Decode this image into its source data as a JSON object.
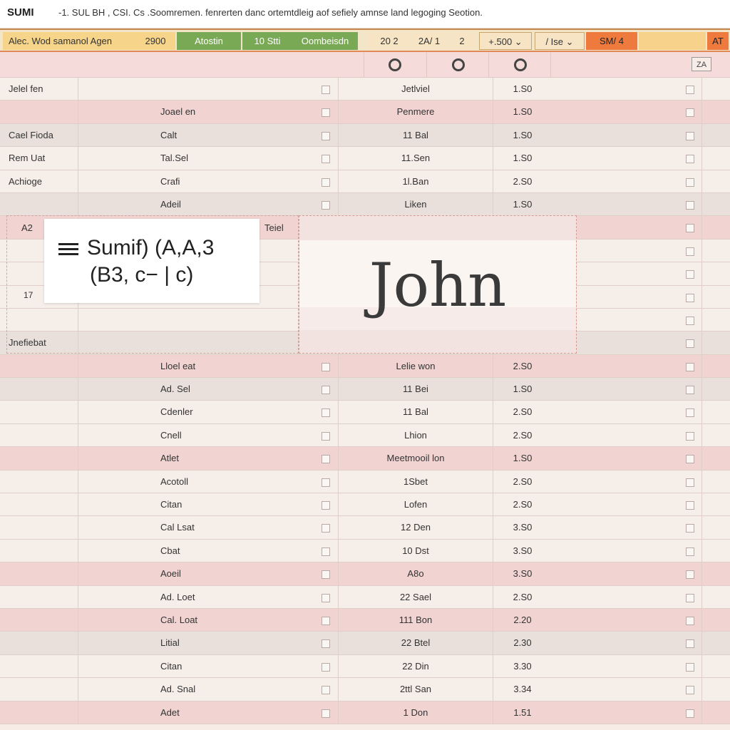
{
  "title_bar": {
    "app": "SUMI",
    "caption": "-1.  SUL BH , CSI. Cs .Soomremen. fenrerten  danc  ortemtdleig  aof  sefiely  amnse  land  legoging  Seotion."
  },
  "toolbar": {
    "items": [
      {
        "label": "Alec. Wod samanol  Agen"
      },
      {
        "label": "2900"
      },
      {
        "label": "Atostin"
      },
      {
        "label": "10  Stti"
      },
      {
        "label": "Oombeisdn"
      },
      {
        "label": "20  2"
      },
      {
        "label": "2A/ 1"
      },
      {
        "label": "2"
      },
      {
        "label": "+.500  ⌄"
      },
      {
        "label": "/  Ise  ⌄"
      },
      {
        "label": "SM/ 4"
      },
      {
        "label": ""
      },
      {
        "label": "AT"
      }
    ]
  },
  "column_header": {
    "corner_label": "ZA"
  },
  "rows": [
    {
      "a": "Jelel  fen",
      "b": "",
      "c": "Jetlviel",
      "d": "1.S0",
      "shade": "light"
    },
    {
      "a": "",
      "b": "Joael  en",
      "c": "Penmere",
      "d": "1.S0",
      "shade": "pink"
    },
    {
      "a": "Cael  Fioda",
      "b": "Calt",
      "c": "11 Bal",
      "d": "1.S0",
      "shade": "grey"
    },
    {
      "a": "Rem  Uat",
      "b": "Tal.Sel",
      "c": "11.Sen",
      "d": "1.S0",
      "shade": "light"
    },
    {
      "a": "Achioge",
      "b": "Crafi",
      "c": "1l.Ban",
      "d": "2.S0",
      "shade": "light"
    },
    {
      "a": "",
      "b": "Adeil",
      "c": "Liken",
      "d": "1.S0",
      "shade": "grey"
    },
    {
      "a": "",
      "b": "",
      "c": "",
      "d": "",
      "shade": "pink"
    },
    {
      "a": "",
      "b": "",
      "c": "",
      "d": "",
      "shade": "light"
    },
    {
      "a": "",
      "b": "",
      "c": "",
      "d": "",
      "shade": "light"
    },
    {
      "a": "",
      "b": "",
      "c": "",
      "d": "",
      "shade": "light"
    },
    {
      "a": "",
      "b": "",
      "c": "",
      "d": "",
      "shade": "light"
    },
    {
      "a": "Jnefiebat",
      "b": "",
      "c": "",
      "d": "",
      "shade": "grey"
    },
    {
      "a": "",
      "b": "Lloel  eat",
      "c": "Lelie  won",
      "d": "2.S0",
      "shade": "pink"
    },
    {
      "a": "",
      "b": "Ad. Sel",
      "c": "11 Bei",
      "d": "1.S0",
      "shade": "grey"
    },
    {
      "a": "",
      "b": "Cdenler",
      "c": "11 Bal",
      "d": "2.S0",
      "shade": "light"
    },
    {
      "a": "",
      "b": "Cnell",
      "c": "Lhion",
      "d": "2.S0",
      "shade": "light"
    },
    {
      "a": "",
      "b": "Atlet",
      "c": "Meetmooil  lon",
      "d": "1.S0",
      "shade": "pink"
    },
    {
      "a": "",
      "b": "Acotoll",
      "c": "1Sbet",
      "d": "2.S0",
      "shade": "light"
    },
    {
      "a": "",
      "b": "Citan",
      "c": "Lofen",
      "d": "2.S0",
      "shade": "light"
    },
    {
      "a": "",
      "b": "Cal  Lsat",
      "c": "12 Den",
      "d": "3.S0",
      "shade": "light"
    },
    {
      "a": "",
      "b": "Cbat",
      "c": "10 Dst",
      "d": "3.S0",
      "shade": "light"
    },
    {
      "a": "",
      "b": "Aoeil",
      "c": "A8o",
      "d": "3.S0",
      "shade": "pink"
    },
    {
      "a": "",
      "b": "Ad. Loet",
      "c": "22 Sael",
      "d": "2.S0",
      "shade": "light"
    },
    {
      "a": "",
      "b": "Cal. Loat",
      "c": "111 Bon",
      "d": "2.20",
      "shade": "pink"
    },
    {
      "a": "",
      "b": "Litial",
      "c": "22 Btel",
      "d": "2.30",
      "shade": "grey"
    },
    {
      "a": "",
      "b": "Citan",
      "c": "22 Din",
      "d": "3.30",
      "shade": "light"
    },
    {
      "a": "",
      "b": "Ad. Snal",
      "c": "2ttl  San",
      "d": "3.34",
      "shade": "light"
    },
    {
      "a": "",
      "b": "Adet",
      "c": "1 Don",
      "d": "1.51",
      "shade": "pink"
    }
  ],
  "overlay": {
    "cell_ref": "A2",
    "side_num": "17",
    "column_tag": "Teiel",
    "formula_line1": "Sumif) (A,A,3",
    "formula_line2": "(B3, c−  | c)",
    "name_preview": "John"
  },
  "colors": {
    "toolbar_green": "#7aa956",
    "toolbar_orange": "#ef7a3e",
    "row_pink": "#f1d4d2",
    "row_light": "#f6eee9"
  }
}
